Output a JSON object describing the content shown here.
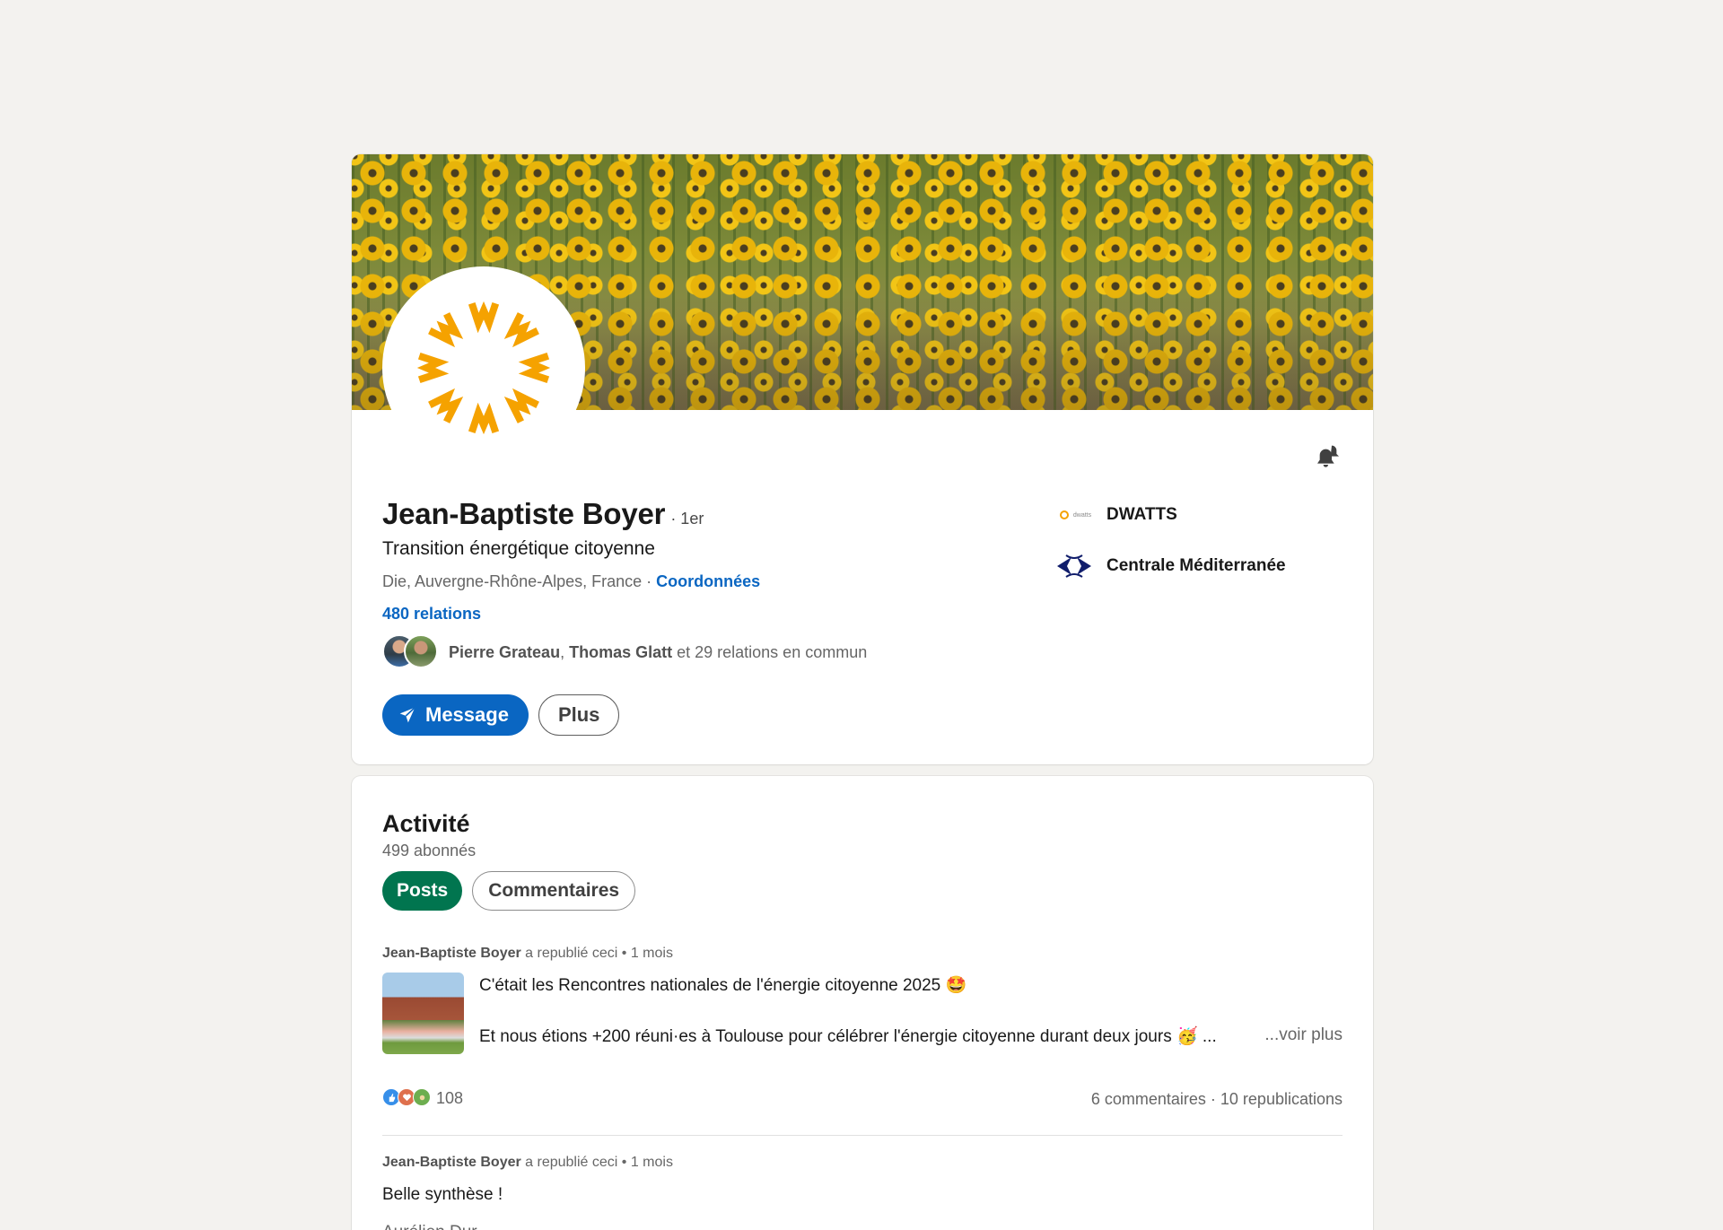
{
  "profile": {
    "name": "Jean-Baptiste Boyer",
    "degree": "· 1er",
    "headline": "Transition énergétique citoyenne",
    "location": "Die, Auvergne-Rhône-Alpes, France · ",
    "coords_label": "Coordonnées",
    "relations": "480 relations",
    "mutual_name_1": "Pierre Grateau",
    "mutual_sep": ", ",
    "mutual_name_2": "Thomas Glatt",
    "mutual_rest": " et 29 relations en commun",
    "message_label": "Message",
    "more_label": "Plus",
    "companies": [
      {
        "name": "DWATTS",
        "logo": "dwatts-logo",
        "logo_text": "dwatts"
      },
      {
        "name": "Centrale Méditerranée",
        "logo": "centrale-mediterranee-logo"
      }
    ]
  },
  "colors": {
    "brand_blue": "#0a66c2",
    "accent_green": "#01754f",
    "sun_orange": "#f5a200"
  },
  "activity": {
    "title": "Activité",
    "followers": "499 abonnés",
    "tabs": [
      {
        "label": "Posts",
        "active": true
      },
      {
        "label": "Commentaires",
        "active": false
      }
    ],
    "posts": [
      {
        "author": "Jean-Baptiste Boyer",
        "meta": " a republié ceci • 1 mois",
        "line1": "C'était les Rencontres nationales de l'énergie citoyenne 2025 🤩",
        "line2": "Et nous étions +200 réuni·es à Toulouse pour célébrer l'énergie citoyenne durant deux jours 🥳 ...",
        "see_more": "...voir plus",
        "reaction_count": "108",
        "stats": "6 commentaires · 10 republications"
      },
      {
        "author": "Jean-Baptiste Boyer",
        "meta": " a republié ceci • 1 mois",
        "line1": "Belle synthèse !",
        "line2_partial": "Aurélien Dur..."
      }
    ]
  }
}
